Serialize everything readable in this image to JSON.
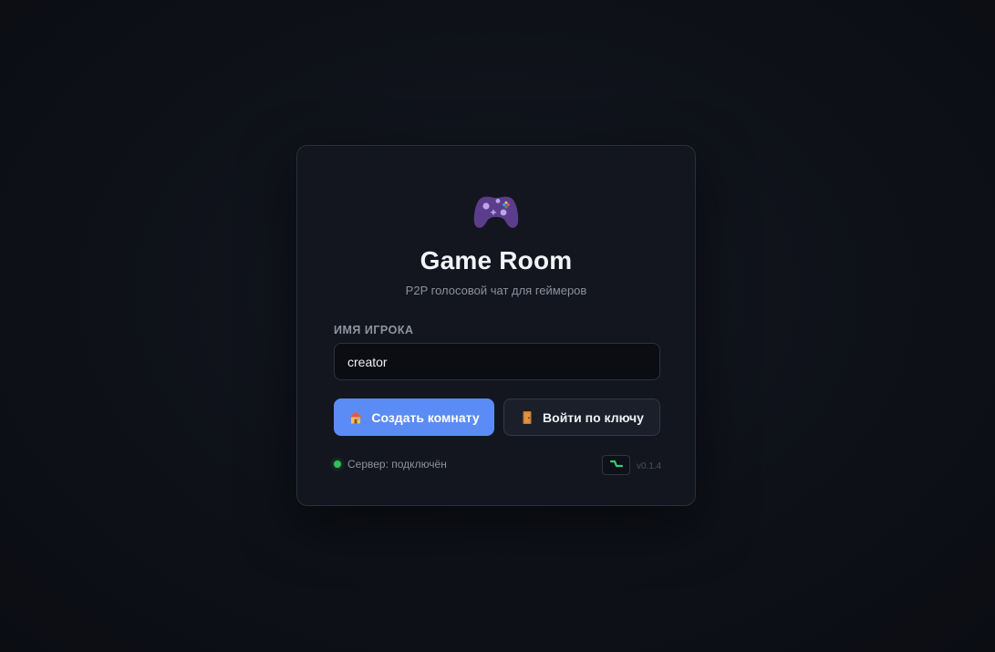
{
  "app": {
    "title": "Game Room",
    "subtitle": "P2P голосовой чат для геймеров"
  },
  "form": {
    "name_label": "ИМЯ ИГРОКА",
    "name_value": "creator"
  },
  "actions": {
    "create_label": "Создать комнату",
    "join_label": "Войти по ключу"
  },
  "footer": {
    "status_text": "Сервер: подключён",
    "version": "v0.1.4"
  },
  "icons": {
    "logo": "gamepad-icon",
    "create": "house-icon",
    "join": "door-icon",
    "net": "signal-icon"
  },
  "colors": {
    "accent": "#5b8cf5",
    "status_ok": "#2fbf5b",
    "gamepad": "#5c3d8c"
  }
}
